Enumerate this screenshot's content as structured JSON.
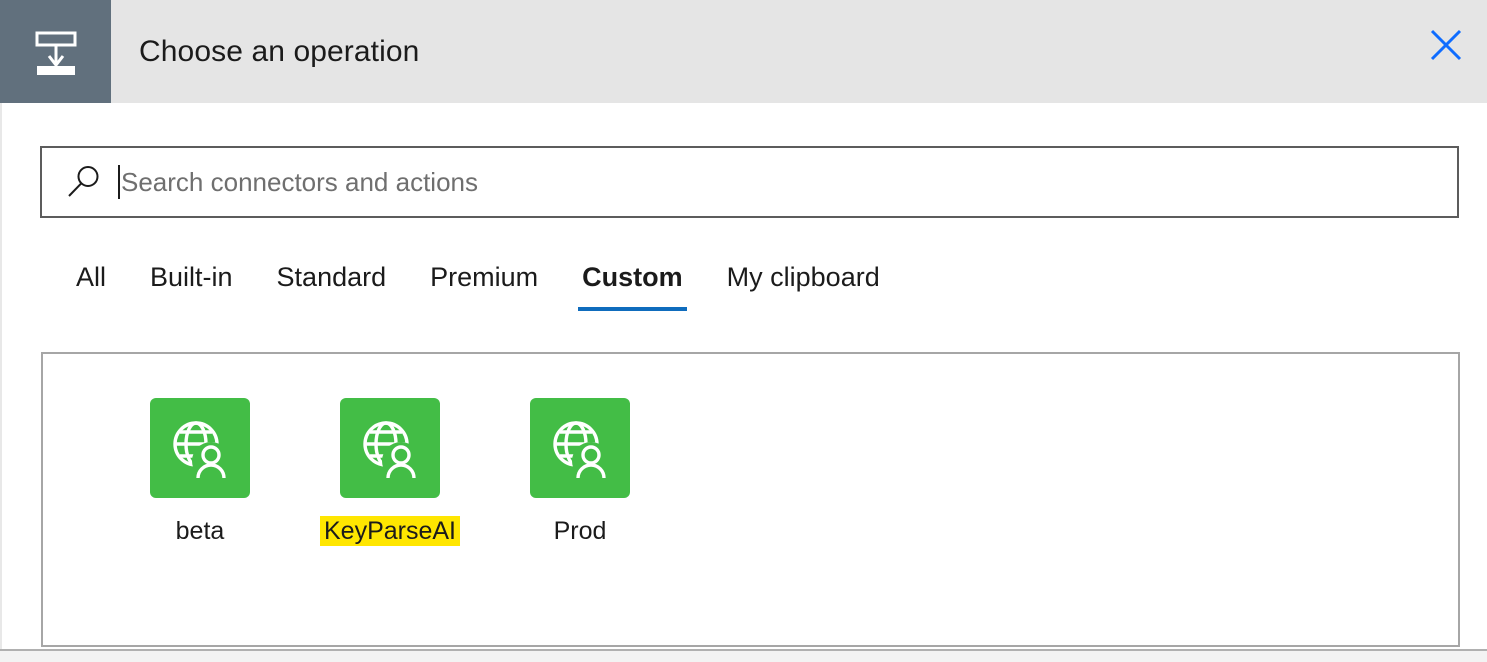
{
  "header": {
    "title": "Choose an operation",
    "icon": "logic-app-flow-icon",
    "close_label": "Close",
    "close_icon": "close-x-icon",
    "icon_block_color": "#61707d",
    "background_color": "#e5e5e5",
    "close_color": "#0f6cff"
  },
  "search": {
    "placeholder": "Search connectors and actions",
    "value": "",
    "icon": "search-magnifier-icon",
    "caret_visible": true
  },
  "tabs": {
    "selected": "Custom",
    "accent_color": "#0f6cbd",
    "items": [
      {
        "label": "All",
        "selected": false
      },
      {
        "label": "Built-in",
        "selected": false
      },
      {
        "label": "Standard",
        "selected": false
      },
      {
        "label": "Premium",
        "selected": false
      },
      {
        "label": "Custom",
        "selected": true
      },
      {
        "label": "My clipboard",
        "selected": false
      }
    ]
  },
  "results": {
    "tile_color": "#43bd46",
    "highlight_color": "#ffe600",
    "connectors": [
      {
        "label": "beta",
        "icon": "globe-user-connector-icon",
        "highlighted": false
      },
      {
        "label": "KeyParseAI",
        "icon": "globe-user-connector-icon",
        "highlighted": true
      },
      {
        "label": "Prod",
        "icon": "globe-user-connector-icon",
        "highlighted": false
      }
    ]
  }
}
